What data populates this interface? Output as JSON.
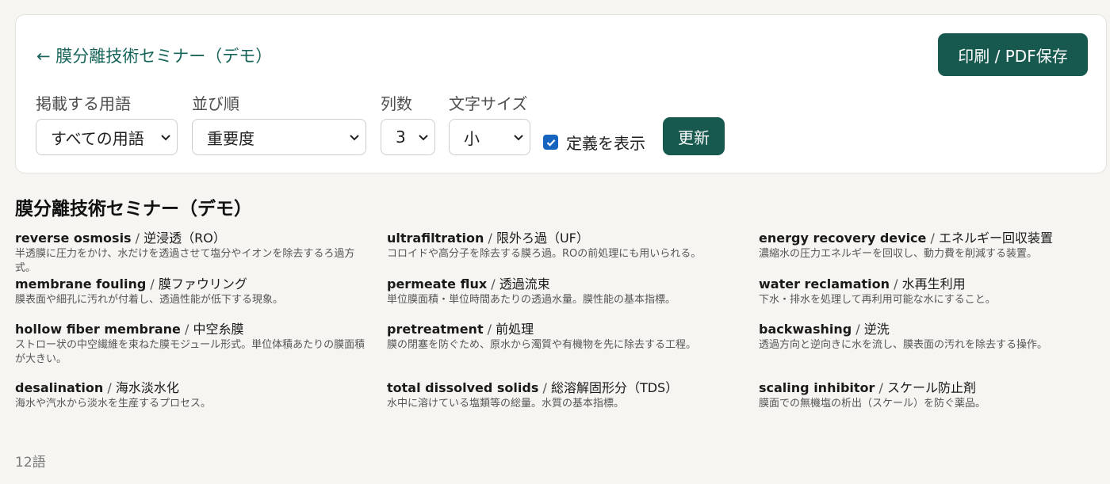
{
  "header": {
    "back_link": "← 膜分離技術セミナー（デモ）",
    "print_button": "印刷 / PDF保存"
  },
  "controls": {
    "terms_filter": {
      "label": "掲載する用語",
      "value": "すべての用語"
    },
    "sort_order": {
      "label": "並び順",
      "value": "重要度"
    },
    "columns": {
      "label": "列数",
      "value": "3"
    },
    "font_size": {
      "label": "文字サイズ",
      "value": "小"
    },
    "show_definitions": {
      "label": "定義を表示",
      "checked": true
    },
    "update_button": "更新"
  },
  "page_title": "膜分離技術セミナー（デモ）",
  "terms": [
    {
      "en": "reverse osmosis",
      "ja": "逆浸透（RO）",
      "def": "半透膜に圧力をかけ、水だけを透過させて塩分やイオンを除去するろ過方式。"
    },
    {
      "en": "membrane fouling",
      "ja": "膜ファウリング",
      "def": "膜表面や細孔に汚れが付着し、透過性能が低下する現象。"
    },
    {
      "en": "hollow fiber membrane",
      "ja": "中空糸膜",
      "def": "ストロー状の中空繊維を束ねた膜モジュール形式。単位体積あたりの膜面積が大きい。"
    },
    {
      "en": "desalination",
      "ja": "海水淡水化",
      "def": "海水や汽水から淡水を生産するプロセス。"
    },
    {
      "en": "ultrafiltration",
      "ja": "限外ろ過（UF）",
      "def": "コロイドや高分子を除去する膜ろ過。ROの前処理にも用いられる。"
    },
    {
      "en": "permeate flux",
      "ja": "透過流束",
      "def": "単位膜面積・単位時間あたりの透過水量。膜性能の基本指標。"
    },
    {
      "en": "pretreatment",
      "ja": "前処理",
      "def": "膜の閉塞を防ぐため、原水から濁質や有機物を先に除去する工程。"
    },
    {
      "en": "total dissolved solids",
      "ja": "総溶解固形分（TDS）",
      "def": "水中に溶けている塩類等の総量。水質の基本指標。"
    },
    {
      "en": "energy recovery device",
      "ja": "エネルギー回収装置",
      "def": "濃縮水の圧力エネルギーを回収し、動力費を削減する装置。"
    },
    {
      "en": "water reclamation",
      "ja": "水再生利用",
      "def": "下水・排水を処理して再利用可能な水にすること。"
    },
    {
      "en": "backwashing",
      "ja": "逆洗",
      "def": "透過方向と逆向きに水を流し、膜表面の汚れを除去する操作。"
    },
    {
      "en": "scaling inhibitor",
      "ja": "スケール防止剤",
      "def": "膜面での無機塩の析出（スケール）を防ぐ薬品。"
    }
  ],
  "term_separator": " / ",
  "count_label": "12語",
  "icons": {
    "back": "arrow-left-icon",
    "select": "chevron-down-icon",
    "checkbox": "check-icon"
  },
  "colors": {
    "accent": "#17594f",
    "link": "#17655a",
    "checkbox": "#1565c0",
    "background": "#f6f5f1"
  }
}
